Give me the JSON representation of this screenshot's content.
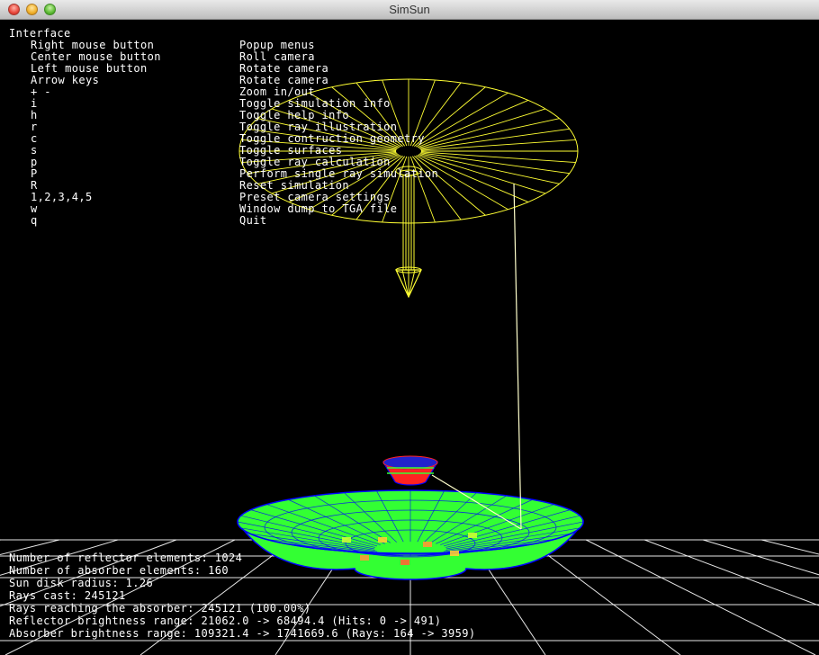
{
  "window": {
    "title": "SimSun"
  },
  "help": {
    "heading": "Interface",
    "rows": [
      {
        "key": "Right mouse button",
        "action": "Popup menus"
      },
      {
        "key": "Center mouse button",
        "action": "Roll camera"
      },
      {
        "key": "Left mouse button",
        "action": "Rotate camera"
      },
      {
        "key": "Arrow keys",
        "action": "Rotate camera"
      },
      {
        "key": "+ -",
        "action": "Zoom in/out"
      },
      {
        "key": "i",
        "action": "Toggle simulation info"
      },
      {
        "key": "h",
        "action": "Toggle help info"
      },
      {
        "key": "r",
        "action": "Toggle ray illustration"
      },
      {
        "key": "c",
        "action": "Toggle contruction geometry"
      },
      {
        "key": "s",
        "action": "Toggle surfaces"
      },
      {
        "key": "p",
        "action": "Toggle ray calculation"
      },
      {
        "key": "P",
        "action": "Perform single ray simulation"
      },
      {
        "key": "R",
        "action": "Reset simulation"
      },
      {
        "key": "1,2,3,4,5",
        "action": "Preset camera settings"
      },
      {
        "key": "w",
        "action": "Window dump to TGA file"
      },
      {
        "key": "q",
        "action": "Quit"
      }
    ]
  },
  "stats": [
    "Number of reflector elements: 1024",
    "Number of absorber elements: 160",
    "Sun disk radius: 1.26",
    "Rays cast: 245121",
    "Rays reaching the absorber: 245121 (100.00%)",
    "Reflector brightness range: 21062.0 -> 68494.4 (Hits: 0 -> 491)",
    "Absorber brightness range: 109321.4 -> 1741669.6 (Rays: 164 -> 3959)"
  ],
  "colors": {
    "background": "#000000",
    "text": "#ffffff",
    "sun_wire": "#ffff33",
    "grid": "#ffffff",
    "reflector_fill": "#33ff33",
    "reflector_edge": "#0000ff",
    "absorber_fill": "#ff2222",
    "ray": "#ffffcc"
  }
}
